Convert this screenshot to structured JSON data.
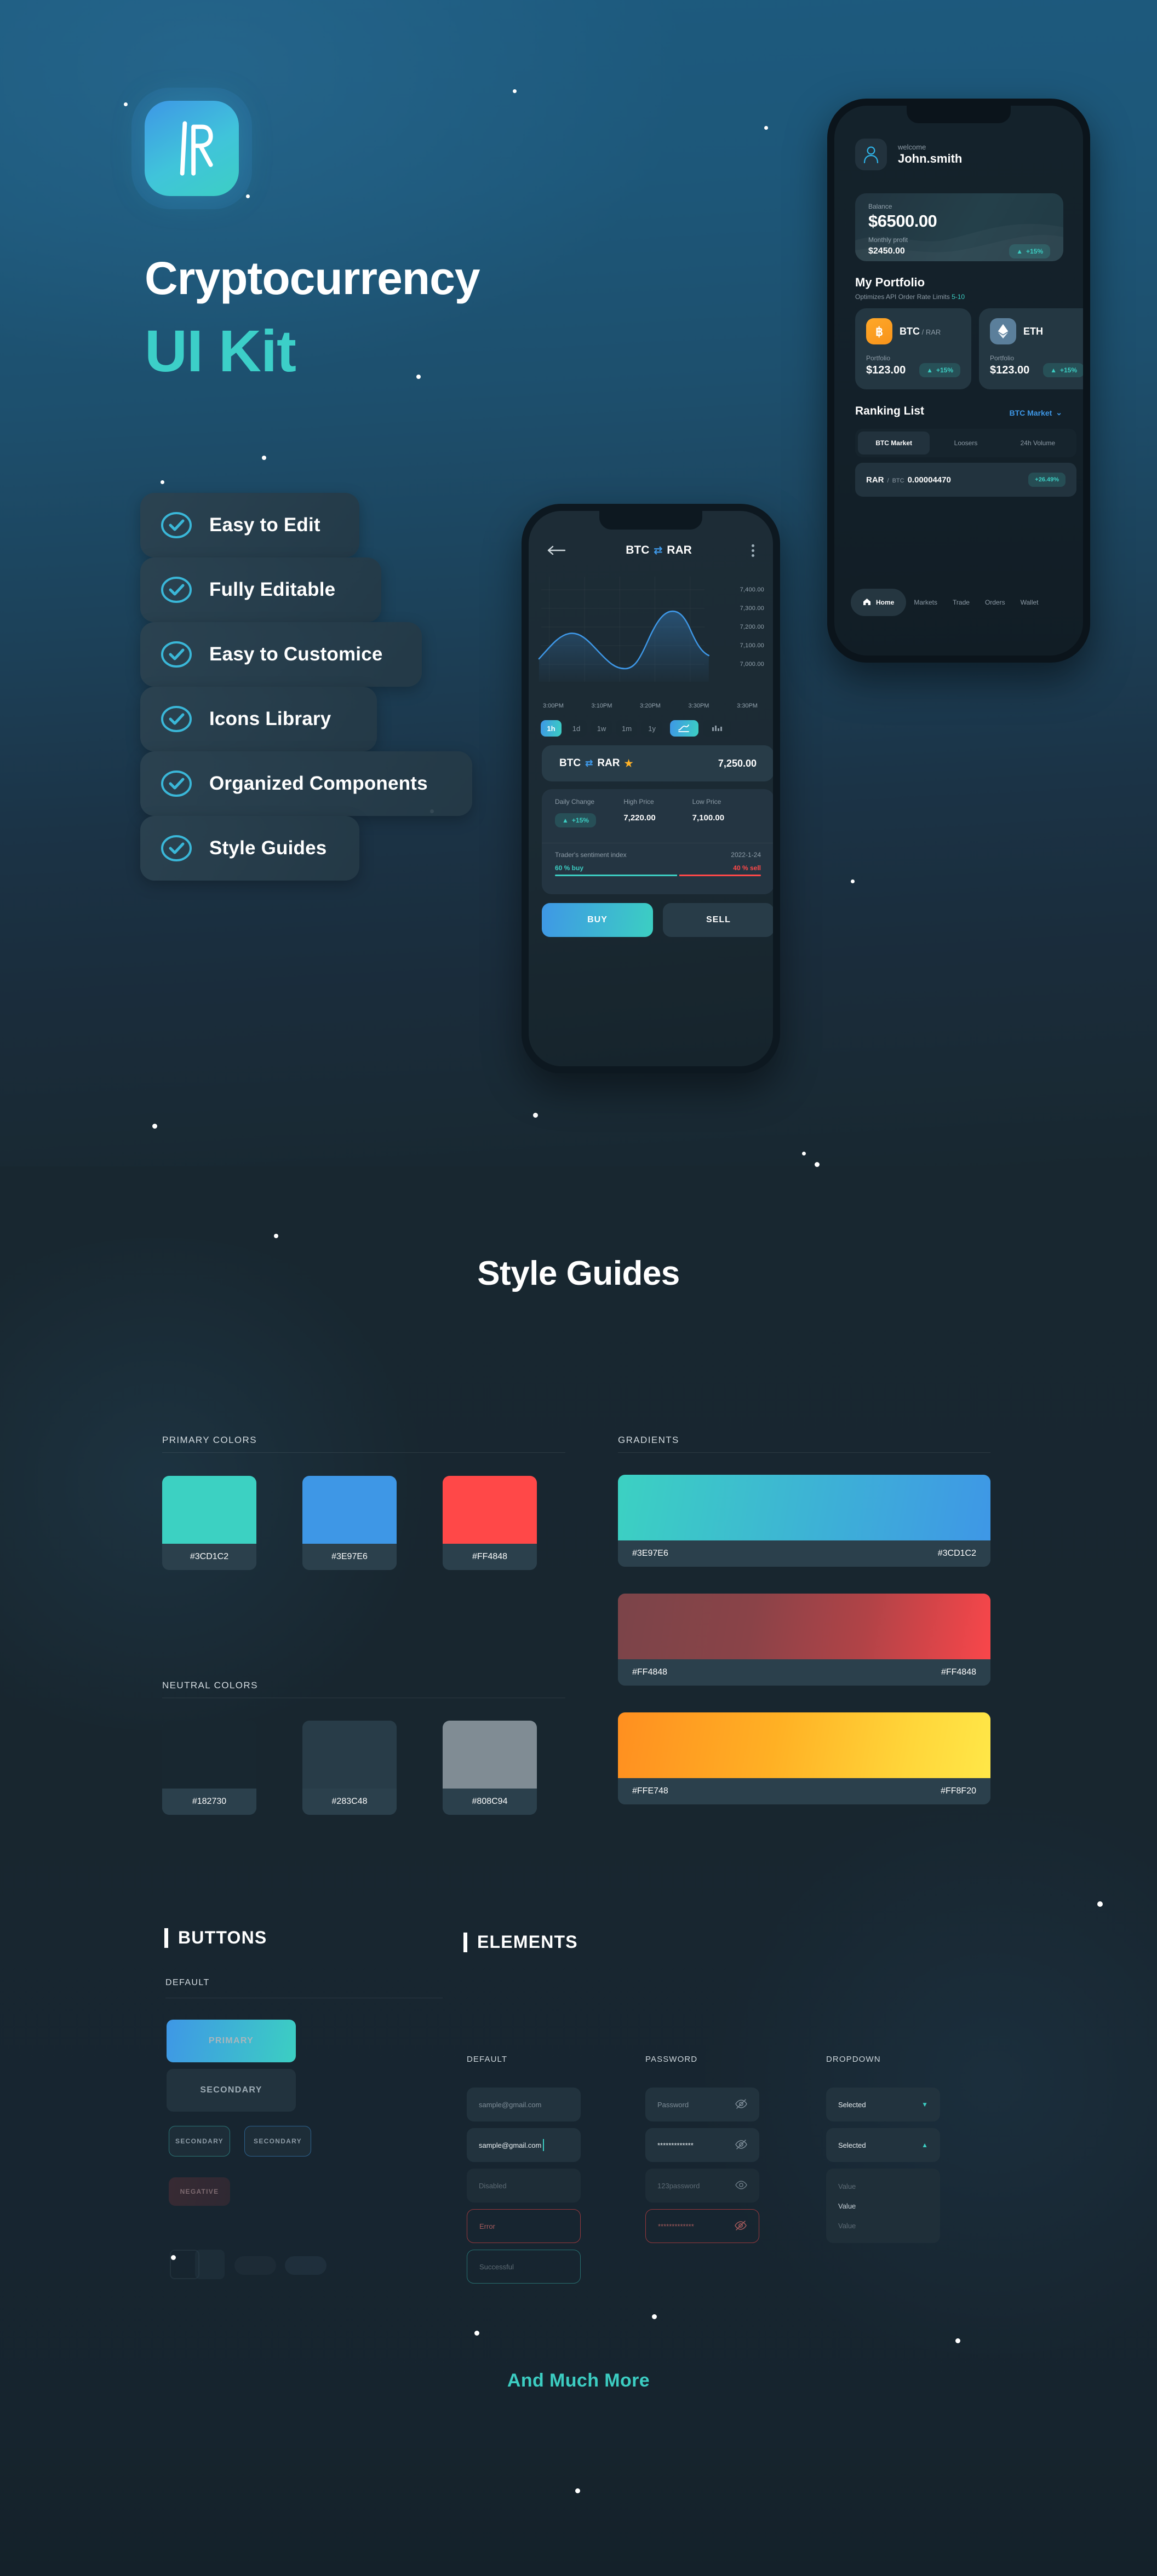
{
  "hero": {
    "logo_icon": "app-logo-icon",
    "title_line1": "Cryptocurrency",
    "title_line2": "UI Kit",
    "features": [
      {
        "label": "Easy to Edit",
        "icon": "check-circle-icon"
      },
      {
        "label": "Fully Editable",
        "icon": "check-circle-icon"
      },
      {
        "label": "Easy to Customice",
        "icon": "check-circle-icon"
      },
      {
        "label": "Icons Library",
        "icon": "check-circle-icon"
      },
      {
        "label": "Organized Components",
        "icon": "check-circle-icon"
      },
      {
        "label": "Style Guides",
        "icon": "check-circle-icon"
      }
    ]
  },
  "phone_chart": {
    "back_icon": "back-arrow-icon",
    "pair_base": "BTC",
    "pair_swap_icon": "swap-icon",
    "pair_quote": "RAR",
    "more_icon": "more-vertical-icon",
    "y_labels": [
      "7,400.00",
      "7,300.00",
      "7,200.00",
      "7,100.00",
      "7,000.00"
    ],
    "x_labels": [
      "3:00PM",
      "3:10PM",
      "3:20PM",
      "3:30PM",
      "3:30PM"
    ],
    "timeframes": [
      {
        "label": "1h",
        "active": true
      },
      {
        "label": "1d",
        "active": false
      },
      {
        "label": "1w",
        "active": false
      },
      {
        "label": "1m",
        "active": false
      },
      {
        "label": "1y",
        "active": false
      }
    ],
    "chart_type_buttons": [
      {
        "icon": "line-chart-icon",
        "active": true
      },
      {
        "icon": "candlestick-chart-icon",
        "active": false
      }
    ],
    "price_card": {
      "pair_base": "BTC",
      "swap_icon": "swap-icon",
      "pair_quote": "RAR",
      "star_icon": "star-icon",
      "price": "7,250.00"
    },
    "stats": {
      "daily_change_label": "Daily Change",
      "daily_change_value": "+15%",
      "daily_change_icon": "triangle-up-icon",
      "high_price_label": "High Price",
      "high_price_value": "7,220.00",
      "low_price_label": "Low Price",
      "low_price_value": "7,100.00"
    },
    "sentiment": {
      "title": "Trader's sentiment index",
      "date": "2022-1-24",
      "buy_label": "60 % buy",
      "sell_label": "40 % sell",
      "buy_pct": 60,
      "sell_pct": 40
    },
    "buy_label": "BUY",
    "sell_label": "SELL"
  },
  "phone_portfolio": {
    "avatar_icon": "user-avatar-icon",
    "welcome_label": "welcome",
    "username": "John.smith",
    "balance_label": "Balance",
    "balance_value": "$6500.00",
    "monthly_profit_label": "Monthly profit",
    "monthly_profit_value": "$2450.00",
    "monthly_profit_change": "+15%",
    "monthly_profit_change_icon": "triangle-up-icon",
    "portfolio_title": "My Portfolio",
    "portfolio_sub_prefix": "Optimizes API Order Rate Limits ",
    "portfolio_sub_value": "5-10",
    "coins": [
      {
        "symbol": "BTC",
        "quote": "RAR",
        "icon": "bitcoin-icon",
        "portfolio_label": "Portfolio",
        "portfolio_value": "$123.00",
        "change": "+15%",
        "change_icon": "triangle-up-icon"
      },
      {
        "symbol": "ETH",
        "quote": "",
        "icon": "ethereum-icon",
        "portfolio_label": "Portfolio",
        "portfolio_value": "$123.00",
        "change": "+15%",
        "change_icon": "triangle-up-icon"
      }
    ],
    "ranking_title": "Ranking List",
    "ranking_selector": "BTC Market",
    "ranking_selector_icon": "chevron-down-icon",
    "ranking_tabs": [
      {
        "label": "BTC Market",
        "active": true
      },
      {
        "label": "Loosers",
        "active": false
      },
      {
        "label": "24h Volume",
        "active": false
      }
    ],
    "ranking_rows": [
      {
        "base": "RAR",
        "quote": "BTC",
        "price": "0.00004470",
        "change": "+26.49%"
      }
    ],
    "nav": [
      {
        "label": "Home",
        "icon": "home-icon",
        "active": true
      },
      {
        "label": "Markets",
        "icon": "markets-icon",
        "active": false
      },
      {
        "label": "Trade",
        "icon": "trade-icon",
        "active": false
      },
      {
        "label": "Orders",
        "icon": "orders-icon",
        "active": false
      },
      {
        "label": "Wallet",
        "icon": "wallet-icon",
        "active": false
      }
    ]
  },
  "style_guides": {
    "heading": "Style Guides",
    "primary_colors_label": "PRIMARY COLORS",
    "neutral_colors_label": "NEUTRAL COLORS",
    "gradients_label": "GRADIENTS",
    "primary_colors": [
      {
        "hex": "#3CD1C2"
      },
      {
        "hex": "#3E97E6"
      },
      {
        "hex": "#FF4848"
      }
    ],
    "neutral_colors": [
      {
        "hex": "#182730"
      },
      {
        "hex": "#283C48"
      },
      {
        "hex": "#808C94"
      }
    ],
    "gradients": [
      {
        "from": "#3E97E6",
        "to": "#3CD1C2"
      },
      {
        "from": "#FF4848",
        "to": "#FF4848"
      },
      {
        "from": "#FFE748",
        "to": "#FF8F20"
      }
    ]
  },
  "buttons_section": {
    "heading": "BUTTONS",
    "default_label": "DEFAULT",
    "primary": "PRIMARY",
    "secondary": "SECONDARY",
    "secondary_outline_teal": "SECONDARY",
    "secondary_outline_blue": "SECONDARY",
    "negative": "NEGATIVE"
  },
  "elements_section": {
    "heading": "ELEMENTS",
    "col_default_label": "DEFAULT",
    "col_password_label": "PASSWORD",
    "col_dropdown_label": "DROPDOWN",
    "default_fields": [
      {
        "state": "placeholder",
        "text": "sample@gmail.com"
      },
      {
        "state": "filled",
        "text": "sample@gmail.com"
      },
      {
        "state": "disabled",
        "text": "Disabled"
      },
      {
        "state": "error",
        "text": "Error"
      },
      {
        "state": "success",
        "text": "Successful"
      }
    ],
    "password_fields": [
      {
        "state": "placeholder",
        "text": "Password",
        "eye_icon": "eye-off-icon"
      },
      {
        "state": "filled",
        "text": "*************",
        "eye_icon": "eye-off-icon"
      },
      {
        "state": "disabled",
        "text": "123password",
        "eye_icon": "eye-icon"
      },
      {
        "state": "error",
        "text": "*************",
        "eye_icon": "eye-off-icon"
      }
    ],
    "dropdowns": [
      {
        "text": "Selected",
        "icon": "caret-down-icon"
      },
      {
        "text": "Selected",
        "icon": "caret-up-icon"
      }
    ],
    "dropdown_options": [
      "Value",
      "Value",
      "Value"
    ]
  },
  "footer": {
    "tagline": "And Much More"
  },
  "chart_data": {
    "type": "line",
    "title": "BTC / RAR",
    "xlabel": "",
    "ylabel": "",
    "grid": true,
    "legend": "none",
    "x": [
      "3:00PM",
      "3:10PM",
      "3:20PM",
      "3:30PM",
      "3:30PM"
    ],
    "ylim": [
      6950,
      7450
    ],
    "ytick_labels": [
      "7,400.00",
      "7,300.00",
      "7,200.00",
      "7,100.00",
      "7,000.00"
    ],
    "ytick_values": [
      7400,
      7300,
      7200,
      7100,
      7000
    ],
    "series": [
      {
        "name": "BTC/RAR price",
        "color": "#3E97E6",
        "values": [
          7070,
          7160,
          7205,
          7190,
          7120,
          7045,
          7035,
          7090,
          7230,
          7300,
          7305,
          7265,
          7190,
          7155
        ]
      }
    ],
    "annotations": {
      "current_price": 7250,
      "high_price": 7220,
      "low_price": 7100,
      "daily_change_pct": 15,
      "sentiment_buy_pct": 60,
      "sentiment_sell_pct": 40,
      "date": "2022-1-24"
    }
  }
}
